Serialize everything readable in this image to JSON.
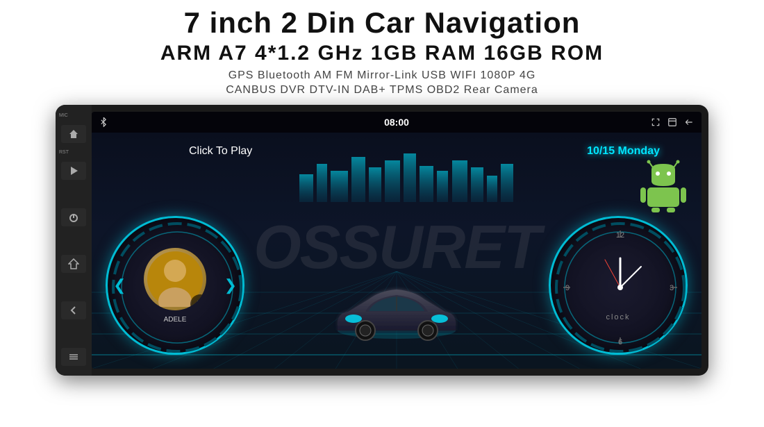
{
  "header": {
    "title": "7 inch 2 Din Car Navigation",
    "specs": "ARM A7 4*1.2 GHz    1GB RAM    16GB ROM",
    "features_line1": "GPS  Bluetooth  AM  FM  Mirror-Link  USB  WIFI  1080P  4G",
    "features_line2": "CANBUS   DVR   DTV-IN   DAB+   TPMS   OBD2   Rear Camera"
  },
  "left_panel": {
    "mic_label": "MIC",
    "rst_label": "RST",
    "buttons": [
      "▷",
      "⏻",
      "⌂",
      "↩",
      "⋯"
    ]
  },
  "status_bar": {
    "time": "08:00",
    "bluetooth_icon": "bluetooth",
    "expand_icon": "expand",
    "window_icon": "window",
    "back_icon": "back"
  },
  "screen": {
    "watermark": "OSSURET",
    "date": "10/15 Monday",
    "click_to_play": "Click To Play",
    "artist": "ADELE",
    "clock_label": "clock"
  },
  "colors": {
    "accent": "#00bcd4",
    "background": "#0a0f1e",
    "text_primary": "#ffffff",
    "text_secondary": "#aaaaaa"
  }
}
